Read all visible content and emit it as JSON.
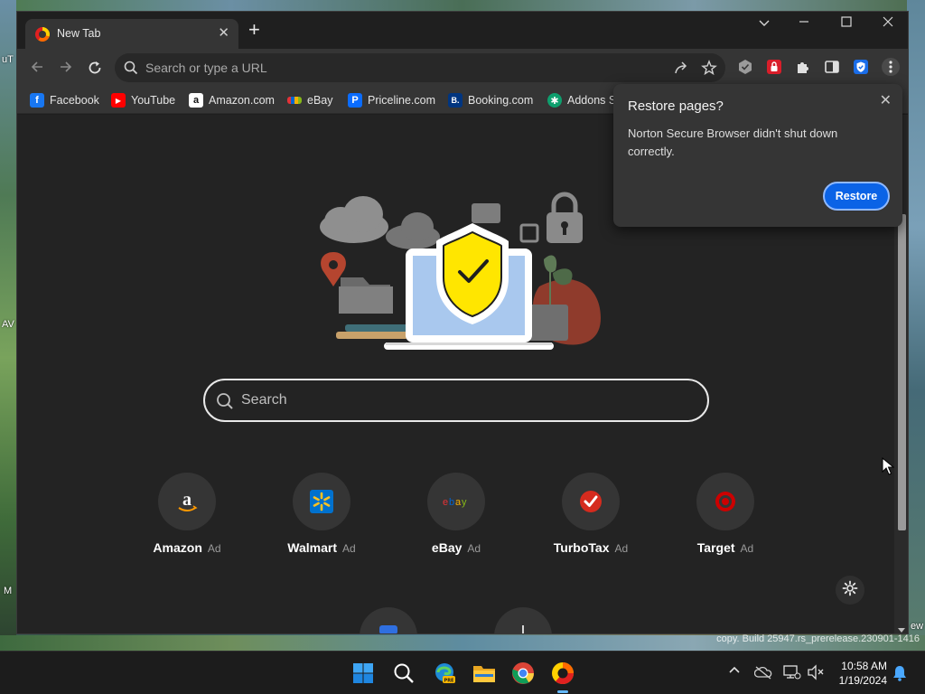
{
  "desktop": {
    "left_labels": [
      "uT",
      "AV",
      "M"
    ],
    "watermark": "copy. Build 25947.rs_prerelease.230901-1416",
    "right_label": "ew"
  },
  "browser": {
    "tab": {
      "title": "New Tab",
      "close_icon": "close-icon"
    },
    "new_tab_label": "+",
    "window_controls": [
      "chevron-down-icon",
      "minimize-icon",
      "maximize-icon",
      "close-icon"
    ],
    "omnibox": {
      "placeholder": "Search or type a URL"
    },
    "bookmarks": [
      {
        "label": "Facebook",
        "icon": "facebook-icon",
        "color": "#1877f2",
        "glyph": "f"
      },
      {
        "label": "YouTube",
        "icon": "youtube-icon",
        "color": "#ff0000",
        "glyph": "▶"
      },
      {
        "label": "Amazon.com",
        "icon": "amazon-icon",
        "color": "#ffffff",
        "glyph": "a"
      },
      {
        "label": "eBay",
        "icon": "ebay-icon",
        "color": "#e53238",
        "glyph": ""
      },
      {
        "label": "Priceline.com",
        "icon": "priceline-icon",
        "color": "#0a6cff",
        "glyph": "P"
      },
      {
        "label": "Booking.com",
        "icon": "booking-icon",
        "color": "#003580",
        "glyph": "B."
      },
      {
        "label": "Addons S",
        "icon": "addons-icon",
        "color": "#0e9f6e",
        "glyph": "✱"
      }
    ]
  },
  "newtab": {
    "search_placeholder": "Search",
    "tiles": [
      {
        "label": "Amazon",
        "ad": "Ad",
        "icon": "amazon-icon"
      },
      {
        "label": "Walmart",
        "ad": "Ad",
        "icon": "walmart-icon"
      },
      {
        "label": "eBay",
        "ad": "Ad",
        "icon": "ebay-icon"
      },
      {
        "label": "TurboTax",
        "ad": "Ad",
        "icon": "turbotax-icon"
      },
      {
        "label": "Target",
        "ad": "Ad",
        "icon": "target-icon"
      }
    ]
  },
  "popup": {
    "title": "Restore pages?",
    "body": "Norton Secure Browser didn't shut down correctly.",
    "button": "Restore"
  },
  "taskbar": {
    "time": "10:58 AM",
    "date": "1/19/2024",
    "apps": [
      "windows-start-icon",
      "search-icon",
      "edge-pre-icon",
      "file-explorer-icon",
      "chrome-icon",
      "norton-browser-icon"
    ]
  },
  "colors": {
    "accent": "#0b63e6",
    "shield_yellow": "#ffe600",
    "browser_bg": "#232323"
  }
}
